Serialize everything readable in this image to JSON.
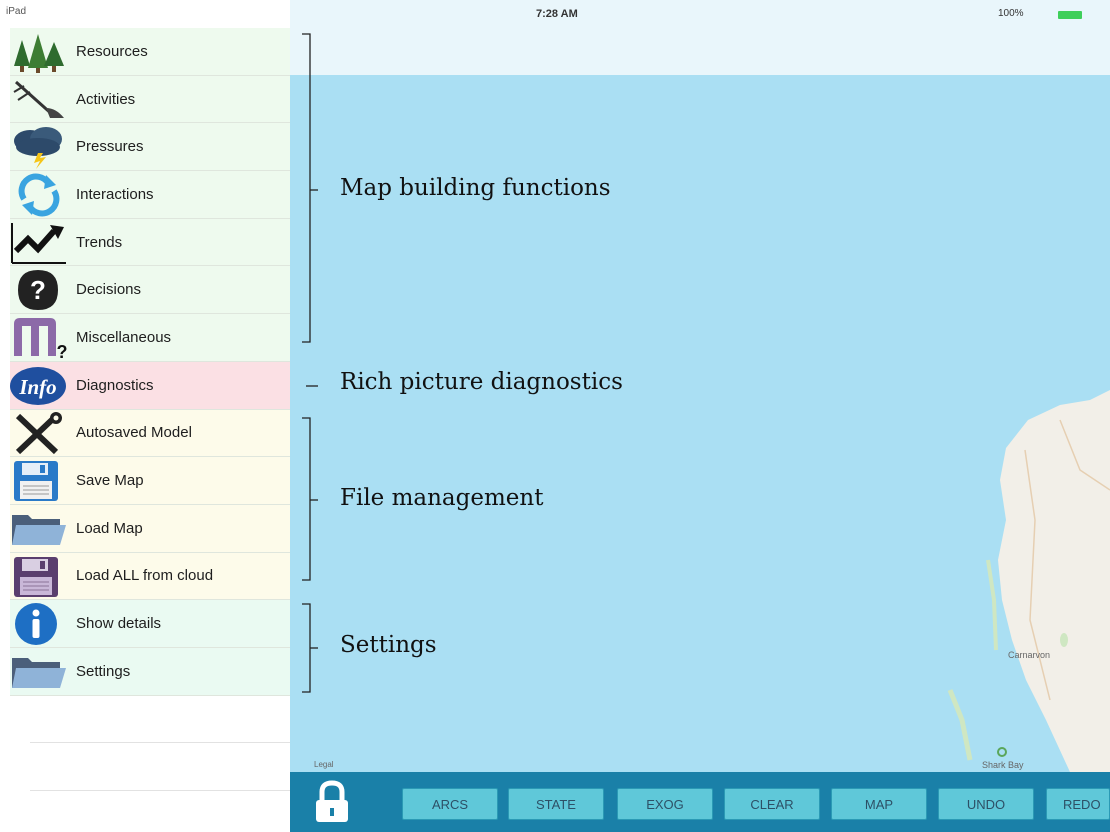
{
  "status_bar": {
    "device": "iPad",
    "time": "7:28 AM",
    "battery": "100%"
  },
  "sidebar": {
    "items": [
      {
        "label": "Resources",
        "icon": "trees-icon",
        "group": "map"
      },
      {
        "label": "Activities",
        "icon": "plough-icon",
        "group": "map"
      },
      {
        "label": "Pressures",
        "icon": "storm-cloud-icon",
        "group": "map"
      },
      {
        "label": "Interactions",
        "icon": "cycle-arrows-icon",
        "group": "map"
      },
      {
        "label": "Trends",
        "icon": "trend-chart-icon",
        "group": "map"
      },
      {
        "label": "Decisions",
        "icon": "question-mark-icon",
        "group": "map"
      },
      {
        "label": "Miscellaneous",
        "icon": "misc-m-icon",
        "group": "map"
      },
      {
        "label": "Diagnostics",
        "icon": "info-icon",
        "group": "diag"
      },
      {
        "label": "Autosaved Model",
        "icon": "tools-icon",
        "group": "file"
      },
      {
        "label": "Save Map",
        "icon": "floppy-disk-icon",
        "group": "file"
      },
      {
        "label": "Load Map",
        "icon": "folder-icon",
        "group": "file"
      },
      {
        "label": "Load ALL from cloud",
        "icon": "floppy-disk-purple-icon",
        "group": "file"
      },
      {
        "label": "Show details",
        "icon": "info-circle-icon",
        "group": "set"
      },
      {
        "label": "Settings",
        "icon": "folder-icon",
        "group": "set"
      }
    ]
  },
  "annotations": {
    "map_building": "Map building functions",
    "diagnostics": "Rich picture diagnostics",
    "file_management": "File management",
    "settings": "Settings"
  },
  "map": {
    "place_label": "Carnarvon",
    "place_label_2": "Shark Bay",
    "legal": "Legal",
    "colors": {
      "water": "#aadff3",
      "land": "#f2efe8",
      "topbar": "#e9f6fb"
    }
  },
  "toolbar": {
    "buttons": [
      "ARCS",
      "STATE",
      "EXOG",
      "CLEAR",
      "MAP",
      "UNDO",
      "REDO"
    ],
    "colors": {
      "bar": "#1a80a8",
      "button": "#5fc8d9"
    }
  }
}
